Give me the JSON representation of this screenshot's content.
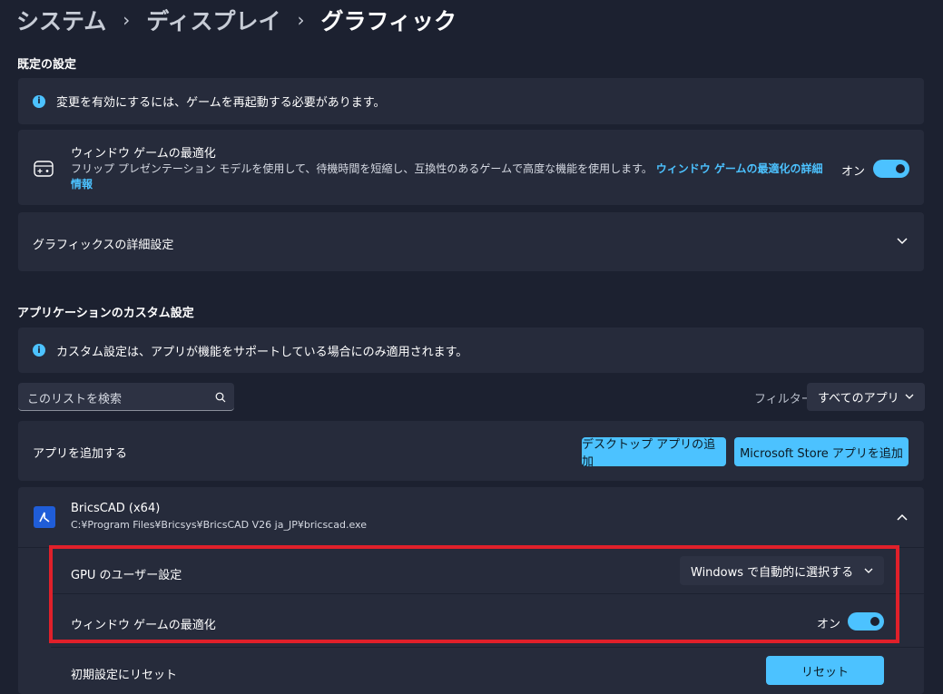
{
  "breadcrumb": {
    "items": [
      "システム",
      "ディスプレイ"
    ],
    "current": "グラフィック",
    "separator": "›"
  },
  "defaults_section": {
    "title": "既定の設定",
    "info_text": "変更を有効にするには、ゲームを再起動する必要があります。",
    "window_game_opt": {
      "title": "ウィンドウ ゲームの最適化",
      "description": "フリップ プレゼンテーション モデルを使用して、待機時間を短縮し、互換性のあるゲームで高度な機能を使用します。",
      "link_text": "ウィンドウ ゲームの最適化の詳細情報",
      "toggle_label": "オン"
    },
    "advanced_graphics": {
      "label": "グラフィックスの詳細設定"
    }
  },
  "custom_section": {
    "title": "アプリケーションのカスタム設定",
    "info_text": "カスタム設定は、アプリが機能をサポートしている場合にのみ適用されます。",
    "search_placeholder": "このリストを検索",
    "filter_label": "フィルター:",
    "filter_value": "すべてのアプリ",
    "add_app_label": "アプリを追加する",
    "add_desktop_button": "デスクトップ アプリの追加",
    "add_store_button": "Microsoft Store アプリを追加"
  },
  "app_entry": {
    "name": "BricsCAD (x64)",
    "path": "C:¥Program Files¥Bricsys¥BricsCAD V26 ja_JP¥bricscad.exe",
    "gpu_pref_label": "GPU のユーザー設定",
    "gpu_pref_value": "Windows で自動的に選択する",
    "window_opt_label": "ウィンドウ ゲームの最適化",
    "window_opt_toggle": "オン",
    "reset_label": "初期設定にリセット",
    "reset_button": "リセット"
  },
  "colors": {
    "accent": "#4cc2ff",
    "highlight": "#e0202a",
    "background": "#1c2130",
    "card": "#262b3b"
  }
}
